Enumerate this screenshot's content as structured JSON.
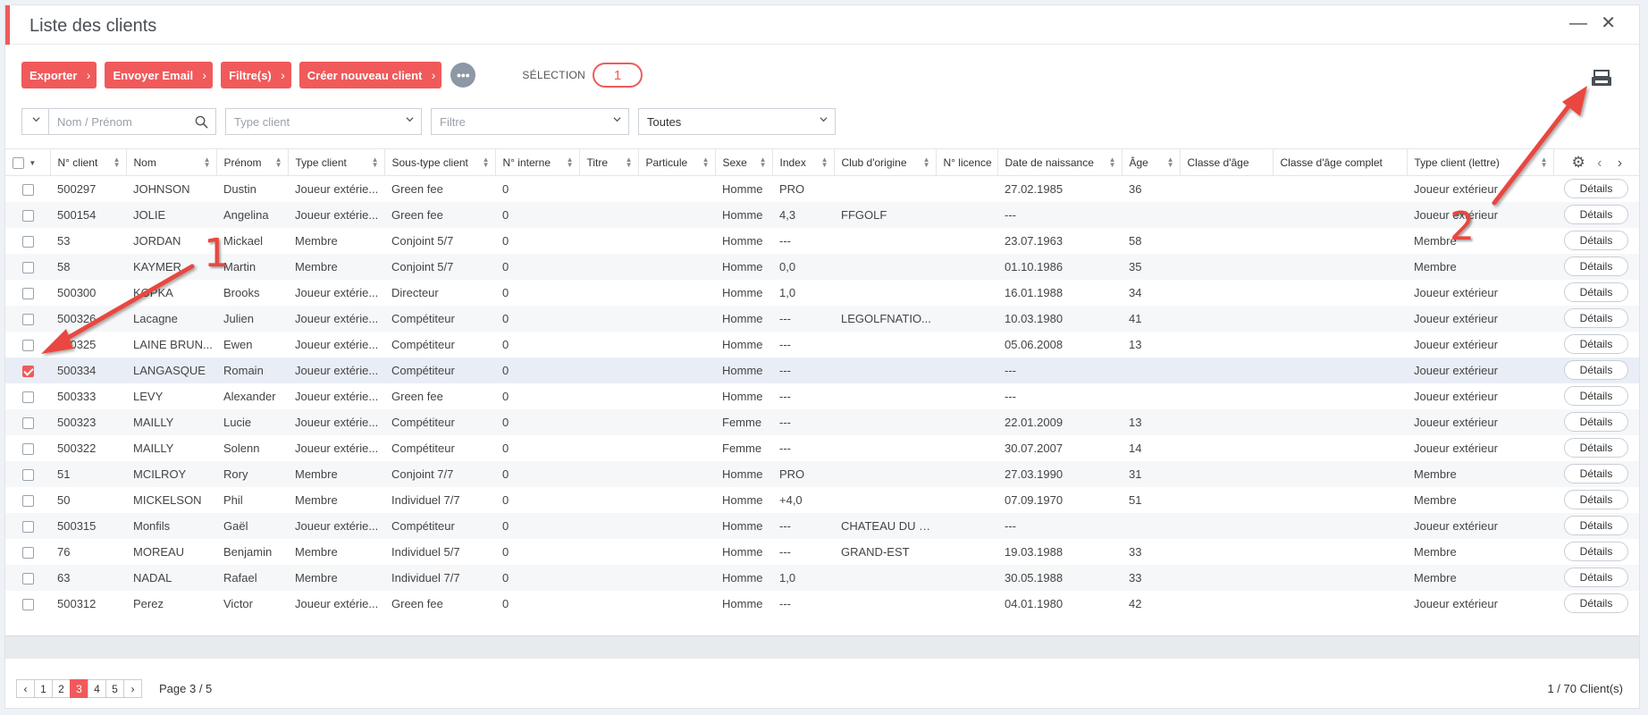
{
  "window": {
    "title": "Liste des clients",
    "minimize_glyph": "—",
    "close_glyph": "✕"
  },
  "toolbar": {
    "buttons": [
      {
        "label": "Exporter"
      },
      {
        "label": "Envoyer Email"
      },
      {
        "label": "Filtre(s)"
      },
      {
        "label": "Créer nouveau client"
      }
    ],
    "more_label": "•••",
    "selection_label": "SÉLECTION",
    "selection_count": "1"
  },
  "filters": {
    "search_placeholder": "Nom / Prénom",
    "type_client_placeholder": "Type client",
    "filtre_placeholder": "Filtre",
    "toutes_value": "Toutes"
  },
  "table": {
    "columns": [
      "N° client",
      "Nom",
      "Prénom",
      "Type client",
      "Sous-type client",
      "N° interne",
      "Titre",
      "Particule",
      "Sexe",
      "Index",
      "Club d'origine",
      "N° licence",
      "Date de naissance",
      "Âge",
      "Classe d'âge",
      "Classe d'âge complet",
      "Type client (lettre)"
    ],
    "details_label": "Détails",
    "rows": [
      {
        "checked": false,
        "cells": [
          "500297",
          "JOHNSON",
          "Dustin",
          "Joueur extérie...",
          "Green fee",
          "0",
          "",
          "",
          "Homme",
          "PRO",
          "",
          "",
          "27.02.1985",
          "36",
          "",
          "",
          "Joueur extérieur"
        ]
      },
      {
        "checked": false,
        "cells": [
          "500154",
          "JOLIE",
          "Angelina",
          "Joueur extérie...",
          "Green fee",
          "0",
          "",
          "",
          "Homme",
          "4,3",
          "FFGOLF",
          "",
          "---",
          "",
          "",
          "",
          "Joueur extérieur"
        ]
      },
      {
        "checked": false,
        "cells": [
          "53",
          "JORDAN",
          "Mickael",
          "Membre",
          "Conjoint 5/7",
          "0",
          "",
          "",
          "Homme",
          "---",
          "",
          "",
          "23.07.1963",
          "58",
          "",
          "",
          "Membre"
        ]
      },
      {
        "checked": false,
        "cells": [
          "58",
          "KAYMER",
          "Martin",
          "Membre",
          "Conjoint 5/7",
          "0",
          "",
          "",
          "Homme",
          "0,0",
          "",
          "",
          "01.10.1986",
          "35",
          "",
          "",
          "Membre"
        ]
      },
      {
        "checked": false,
        "cells": [
          "500300",
          "KOPKA",
          "Brooks",
          "Joueur extérie...",
          "Directeur",
          "0",
          "",
          "",
          "Homme",
          "1,0",
          "",
          "",
          "16.01.1988",
          "34",
          "",
          "",
          "Joueur extérieur"
        ]
      },
      {
        "checked": false,
        "cells": [
          "500326",
          "Lacagne",
          "Julien",
          "Joueur extérie...",
          "Compétiteur",
          "0",
          "",
          "",
          "Homme",
          "---",
          "LEGOLFNATIO...",
          "",
          "10.03.1980",
          "41",
          "",
          "",
          "Joueur extérieur"
        ]
      },
      {
        "checked": false,
        "cells": [
          "500325",
          "LAINE BRUN...",
          "Ewen",
          "Joueur extérie...",
          "Compétiteur",
          "0",
          "",
          "",
          "Homme",
          "---",
          "",
          "",
          "05.06.2008",
          "13",
          "",
          "",
          "Joueur extérieur"
        ]
      },
      {
        "checked": true,
        "cells": [
          "500334",
          "LANGASQUE",
          "Romain",
          "Joueur extérie...",
          "Compétiteur",
          "0",
          "",
          "",
          "Homme",
          "---",
          "",
          "",
          "---",
          "",
          "",
          "",
          "Joueur extérieur"
        ]
      },
      {
        "checked": false,
        "cells": [
          "500333",
          "LEVY",
          "Alexander",
          "Joueur extérie...",
          "Green fee",
          "0",
          "",
          "",
          "Homme",
          "---",
          "",
          "",
          "---",
          "",
          "",
          "",
          "Joueur extérieur"
        ]
      },
      {
        "checked": false,
        "cells": [
          "500323",
          "MAILLY",
          "Lucie",
          "Joueur extérie...",
          "Compétiteur",
          "0",
          "",
          "",
          "Femme",
          "---",
          "",
          "",
          "22.01.2009",
          "13",
          "",
          "",
          "Joueur extérieur"
        ]
      },
      {
        "checked": false,
        "cells": [
          "500322",
          "MAILLY",
          "Solenn",
          "Joueur extérie...",
          "Compétiteur",
          "0",
          "",
          "",
          "Femme",
          "---",
          "",
          "",
          "30.07.2007",
          "14",
          "",
          "",
          "Joueur extérieur"
        ]
      },
      {
        "checked": false,
        "cells": [
          "51",
          "MCILROY",
          "Rory",
          "Membre",
          "Conjoint 7/7",
          "0",
          "",
          "",
          "Homme",
          "PRO",
          "",
          "",
          "27.03.1990",
          "31",
          "",
          "",
          "Membre"
        ]
      },
      {
        "checked": false,
        "cells": [
          "50",
          "MICKELSON",
          "Phil",
          "Membre",
          "Individuel 7/7",
          "0",
          "",
          "",
          "Homme",
          "+4,0",
          "",
          "",
          "07.09.1970",
          "51",
          "",
          "",
          "Membre"
        ]
      },
      {
        "checked": false,
        "cells": [
          "500315",
          "Monfils",
          "Gaël",
          "Joueur extérie...",
          "Compétiteur",
          "0",
          "",
          "",
          "Homme",
          "---",
          "CHATEAU DU B...",
          "",
          "---",
          "",
          "",
          "",
          "Joueur extérieur"
        ]
      },
      {
        "checked": false,
        "cells": [
          "76",
          "MOREAU",
          "Benjamin",
          "Membre",
          "Individuel 5/7",
          "0",
          "",
          "",
          "Homme",
          "---",
          "GRAND-EST",
          "",
          "19.03.1988",
          "33",
          "",
          "",
          "Membre"
        ]
      },
      {
        "checked": false,
        "cells": [
          "63",
          "NADAL",
          "Rafael",
          "Membre",
          "Individuel 7/7",
          "0",
          "",
          "",
          "Homme",
          "1,0",
          "",
          "",
          "30.05.1988",
          "33",
          "",
          "",
          "Membre"
        ]
      },
      {
        "checked": false,
        "cells": [
          "500312",
          "Perez",
          "Victor",
          "Joueur extérie...",
          "Green fee",
          "0",
          "",
          "",
          "Homme",
          "---",
          "",
          "",
          "04.01.1980",
          "42",
          "",
          "",
          "Joueur extérieur"
        ]
      }
    ]
  },
  "pagination": {
    "prev": "‹",
    "next": "›",
    "pages": [
      "1",
      "2",
      "3",
      "4",
      "5"
    ],
    "current": "3",
    "page_label": "Page 3 / 5",
    "total_label": "1 / 70 Client(s)"
  },
  "annotations": {
    "marker_1": "1",
    "marker_2": "2"
  },
  "colors": {
    "accent": "#f05a5b",
    "annotation": "#e9473f"
  }
}
